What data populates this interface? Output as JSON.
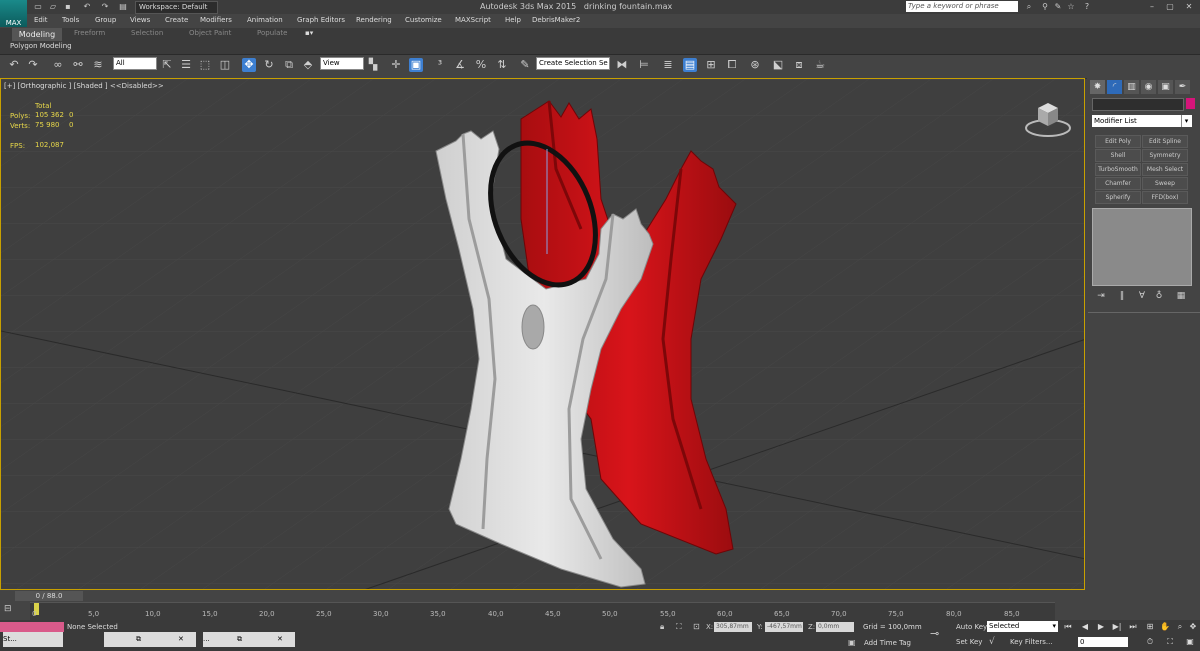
{
  "title": {
    "app": "Autodesk 3ds Max  2015",
    "file": "drinking fountain.max",
    "workspace": "Workspace: Default",
    "search_placeholder": "Type a keyword or phrase"
  },
  "menu": [
    "Edit",
    "Tools",
    "Group",
    "Views",
    "Create",
    "Modifiers",
    "Animation",
    "Graph Editors",
    "Rendering",
    "Customize",
    "MAXScript",
    "Help",
    "DebrisMaker2"
  ],
  "ribbon": {
    "tabs": [
      "Modeling",
      "Freeform",
      "Selection",
      "Object Paint",
      "Populate"
    ],
    "panel_label": "Polygon Modeling"
  },
  "toolbar": {
    "filter": "All",
    "ref_coord": "View",
    "named_selection": "Create Selection Se"
  },
  "viewport": {
    "label": "[+] [Orthographic ] [Shaded ]  <<Disabled>>",
    "stats": {
      "header": "Total",
      "polys_label": "Polys:",
      "polys_total": "105 362",
      "polys_sel": "0",
      "verts_label": "Verts:",
      "verts_total": "75 980",
      "verts_sel": "0",
      "fps_label": "FPS:",
      "fps": "102,087"
    }
  },
  "command_panel": {
    "modifier_list": "Modifier List",
    "buttons": [
      "Edit Poly",
      "Edit Spline",
      "Shell",
      "Symmetry",
      "TurboSmooth",
      "Mesh Select",
      "Chamfer",
      "Sweep",
      "Spherify",
      "FFD(box)"
    ]
  },
  "timeline": {
    "frame": "0 / 88.0",
    "ticks": [
      "0",
      "5,0",
      "10,0",
      "15,0",
      "20,0",
      "25,0",
      "30,0",
      "35,0",
      "40,0",
      "45,0",
      "50,0",
      "55,0",
      "60,0",
      "65,0",
      "70,0",
      "75,0",
      "80,0",
      "85,0"
    ]
  },
  "status": {
    "tasks": [
      "St...",
      "",
      "..."
    ],
    "selection": "None Selected",
    "x_label": "X:",
    "x": "305,87mm",
    "y_label": "Y:",
    "y": "-467,57mm",
    "z_label": "Z:",
    "z": "0,0mm",
    "grid": "Grid = 100,0mm",
    "add_time_tag": "Add Time Tag",
    "auto_key": "Auto Key",
    "set_key": "Set Key",
    "key_mode": "Selected",
    "key_filters": "Key Filters...",
    "current_frame": "0"
  },
  "colors": {
    "object_color": "#d5147a",
    "accent": "#3d7fd1",
    "viewport_border": "#c8a000"
  }
}
